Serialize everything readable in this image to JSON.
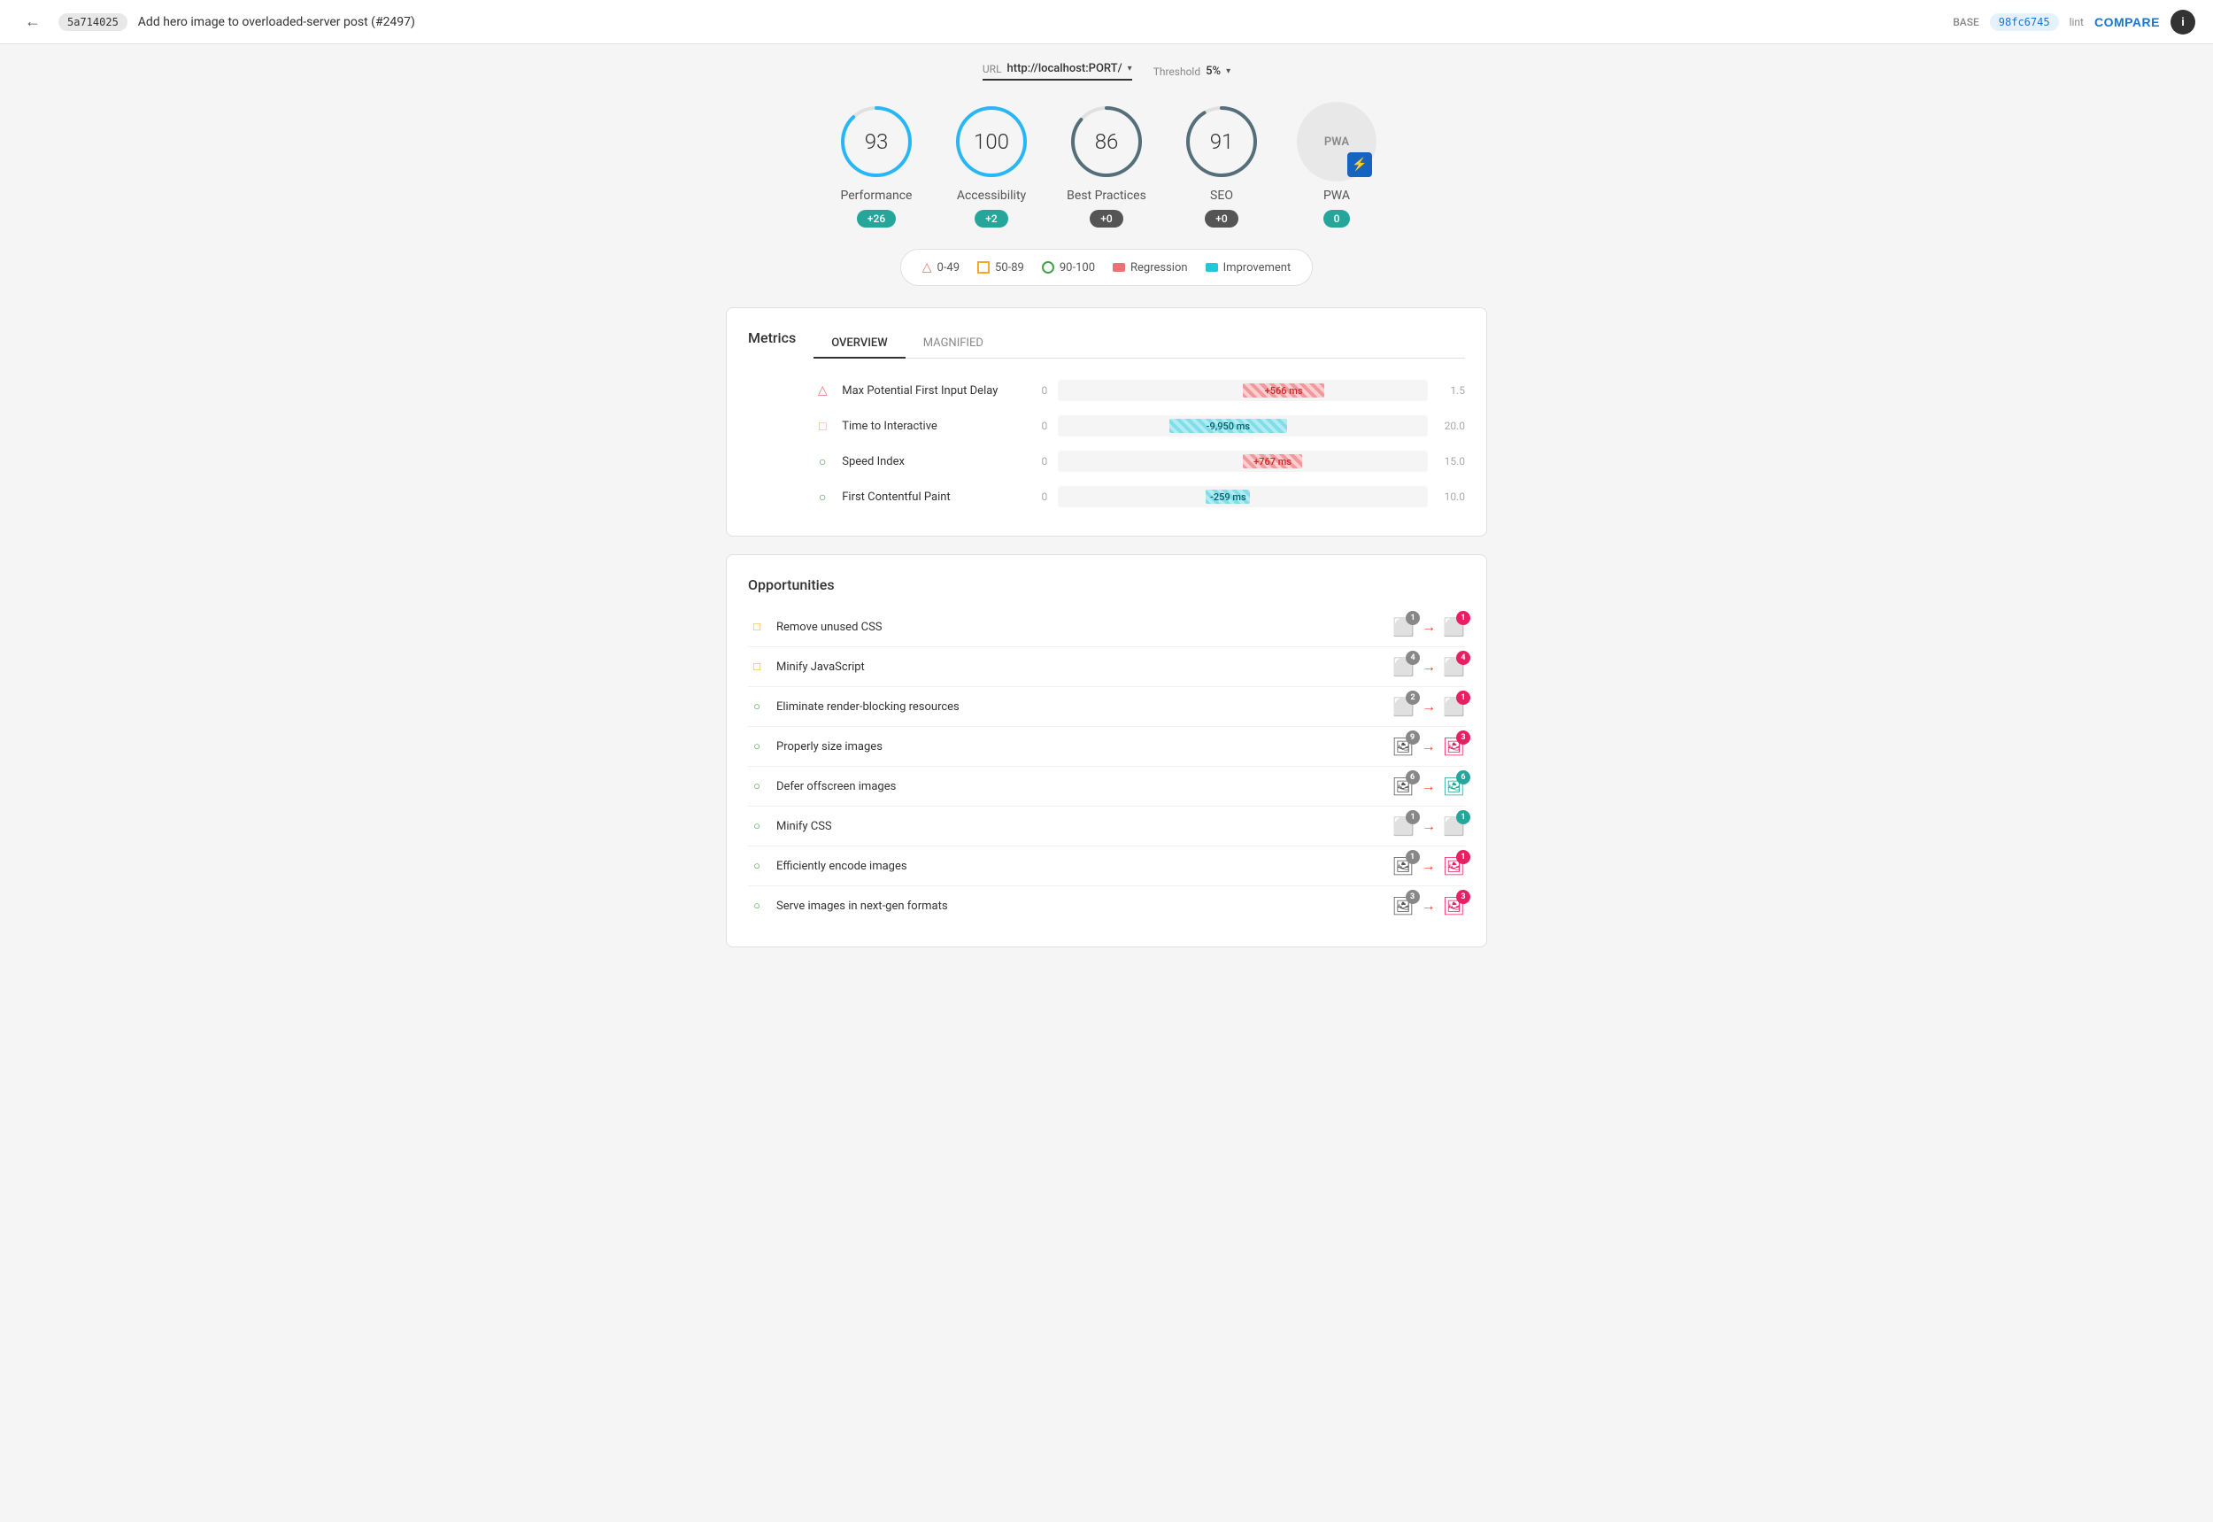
{
  "header": {
    "back_label": "←",
    "commit_base": "5a714025",
    "commit_title": "Add hero image to overloaded-server post (#2497)",
    "base_label": "BASE",
    "commit_head": "98fc6745",
    "head_label": "lint",
    "compare_label": "COMPARE",
    "info_label": "i"
  },
  "url_bar": {
    "url_label": "URL",
    "url_value": "http://localhost:PORT/",
    "threshold_label": "Threshold",
    "threshold_value": "5%"
  },
  "scores": [
    {
      "id": "performance",
      "value": "93",
      "label": "Performance",
      "badge": "+26",
      "badge_type": "teal",
      "color": "#29b6f6",
      "stroke": 251
    },
    {
      "id": "accessibility",
      "value": "100",
      "label": "Accessibility",
      "badge": "+2",
      "badge_type": "teal",
      "color": "#29b6f6",
      "stroke": 270
    },
    {
      "id": "best-practices",
      "value": "86",
      "label": "Best Practices",
      "badge": "+0",
      "badge_type": "dark",
      "color": "#546e7a",
      "stroke": 231
    },
    {
      "id": "seo",
      "value": "91",
      "label": "SEO",
      "badge": "+0",
      "badge_type": "dark",
      "color": "#546e7a",
      "stroke": 245
    }
  ],
  "pwa": {
    "label": "PWA",
    "badge": "0",
    "badge_type": "teal"
  },
  "legend": {
    "items": [
      {
        "type": "triangle",
        "label": "0-49"
      },
      {
        "type": "square-orange",
        "label": "50-89"
      },
      {
        "type": "circle-green",
        "label": "90-100"
      },
      {
        "type": "regression",
        "label": "Regression"
      },
      {
        "type": "improvement",
        "label": "Improvement"
      }
    ]
  },
  "metrics": {
    "title": "Metrics",
    "tabs": [
      {
        "id": "overview",
        "label": "OVERVIEW",
        "active": true
      },
      {
        "id": "magnified",
        "label": "MAGNIFIED",
        "active": false
      }
    ],
    "rows": [
      {
        "id": "max-fid",
        "icon_type": "triangle",
        "name": "Max Potential First Input Delay",
        "start": "0",
        "bar_value": "+566 ms",
        "bar_type": "regression",
        "bar_left": "50%",
        "bar_width": "20%",
        "end": "1.5"
      },
      {
        "id": "tti",
        "icon_type": "square-orange",
        "name": "Time to Interactive",
        "start": "0",
        "bar_value": "-9,950 ms",
        "bar_type": "improvement",
        "bar_left": "30%",
        "bar_width": "30%",
        "end": "20.0"
      },
      {
        "id": "speed-index",
        "icon_type": "circle-green",
        "name": "Speed Index",
        "start": "0",
        "bar_value": "+767 ms",
        "bar_type": "regression",
        "bar_left": "50%",
        "bar_width": "16%",
        "end": "15.0"
      },
      {
        "id": "fcp",
        "icon_type": "circle-green",
        "name": "First Contentful Paint",
        "start": "0",
        "bar_value": "-259 ms",
        "bar_type": "improvement",
        "bar_left": "45%",
        "bar_width": "10%",
        "end": "10.0"
      }
    ]
  },
  "opportunities": {
    "title": "Opportunities",
    "rows": [
      {
        "id": "unused-css",
        "icon_type": "square-orange",
        "name": "Remove unused CSS",
        "base_badge": "1",
        "base_badge_type": "gray",
        "head_badge": "1",
        "head_badge_type": "pink",
        "icon_type_file": "page"
      },
      {
        "id": "minify-js",
        "icon_type": "square-orange",
        "name": "Minify JavaScript",
        "base_badge": "4",
        "base_badge_type": "gray",
        "head_badge": "4",
        "head_badge_type": "pink",
        "icon_type_file": "page"
      },
      {
        "id": "render-blocking",
        "icon_type": "circle-green",
        "name": "Eliminate render-blocking resources",
        "base_badge": "2",
        "base_badge_type": "gray",
        "head_badge": "1",
        "head_badge_type": "pink",
        "icon_type_file": "page"
      },
      {
        "id": "size-images",
        "icon_type": "circle-green",
        "name": "Properly size images",
        "base_badge": "9",
        "base_badge_type": "gray",
        "head_badge": "3",
        "head_badge_type": "pink",
        "icon_type_file": "image"
      },
      {
        "id": "defer-offscreen",
        "icon_type": "circle-green",
        "name": "Defer offscreen images",
        "base_badge": "6",
        "base_badge_type": "gray",
        "head_badge": "6",
        "head_badge_type": "teal",
        "icon_type_file": "image"
      },
      {
        "id": "minify-css",
        "icon_type": "circle-green",
        "name": "Minify CSS",
        "base_badge": "1",
        "base_badge_type": "gray",
        "head_badge": "1",
        "head_badge_type": "teal",
        "icon_type_file": "page"
      },
      {
        "id": "encode-images",
        "icon_type": "circle-green",
        "name": "Efficiently encode images",
        "base_badge": "1",
        "base_badge_type": "gray",
        "head_badge": "1",
        "head_badge_type": "pink",
        "icon_type_file": "image"
      },
      {
        "id": "next-gen",
        "icon_type": "circle-green",
        "name": "Serve images in next-gen formats",
        "base_badge": "3",
        "base_badge_type": "gray",
        "head_badge": "3",
        "head_badge_type": "pink",
        "icon_type_file": "image"
      }
    ]
  }
}
